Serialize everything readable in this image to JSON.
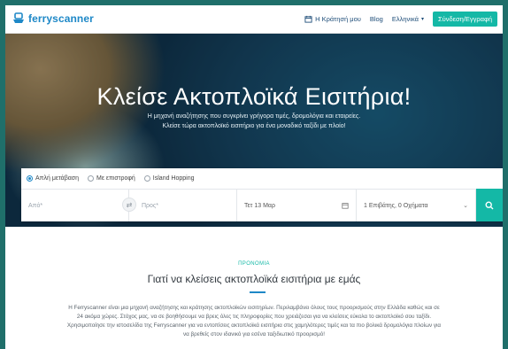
{
  "brand": {
    "name": "ferryscanner",
    "accent": "#14b8a6",
    "blue": "#1e88c7"
  },
  "header": {
    "bookings_label": "Η Κράτησή μου",
    "blog_label": "Blog",
    "language_label": "Ελληνικά",
    "login_label": "Σύνδεση/Εγγραφή"
  },
  "hero": {
    "title": "Κλείσε Ακτοπλοϊκά Εισιτήρια!",
    "subtitle_line1": "Η μηχανή αναζήτησης που συγκρίνει γρήγορα τιμές, δρομολόγια και εταιρείες.",
    "subtitle_line2": "Κλείσε τώρα ακτοπλοϊκό εισιτήριο για ένα μοναδικό ταξίδι με πλοίο!"
  },
  "search": {
    "trip_types": [
      {
        "label": "Απλή μετάβαση",
        "selected": true
      },
      {
        "label": "Με επιστροφή",
        "selected": false
      },
      {
        "label": "Island Hopping",
        "selected": false
      }
    ],
    "from_placeholder": "Από*",
    "to_placeholder": "Προς*",
    "date_value": "Τετ 13 Μαρ",
    "passengers_value": "1 Επιβάτης, 0 Οχήματα"
  },
  "why": {
    "tag": "ΠΡΟΝΟΜΙΑ",
    "title": "Γιατί να κλείσεις ακτοπλοϊκά εισιτήρια με εμάς",
    "line1": "Η Ferryscanner είναι μια μηχανή αναζήτησης και κράτησης ακτοπλοϊκών εισιτηρίων. Περιλαμβάνει όλους τους προορισμούς στην Ελλάδα καθώς και σε",
    "line2": "24 ακόμα χώρες. Στόχος μας, να σε βοηθήσουμε να βρεις όλες τις πληροφορίες που χρειάζεσαι για να κλείσεις εύκολα το ακτοπλοϊκό σου ταξίδι.",
    "line3": "Χρησιμοποίησε την ιστοσελίδα της Ferryscanner για να εντοπίσεις ακτοπλοϊκά εισιτήρια στις χαμηλότερες τιμές και τα πιο βολικά δρομολόγια πλοίων για",
    "line4": "να βρεθείς στον ιδανικό για εσένα ταξιδιωτικό προορισμό!"
  }
}
